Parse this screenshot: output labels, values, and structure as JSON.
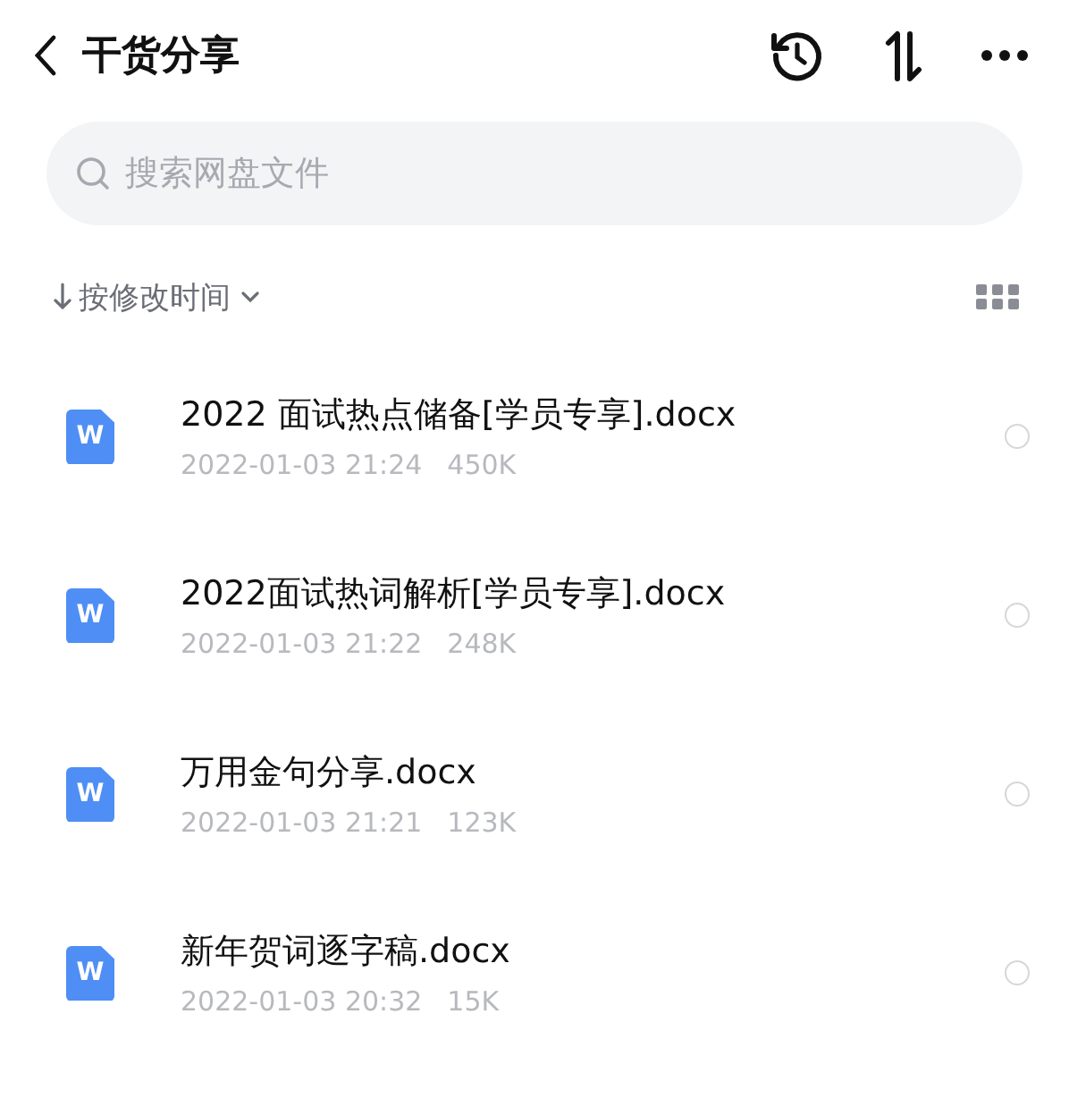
{
  "header": {
    "title": "干货分享"
  },
  "search": {
    "placeholder": "搜索网盘文件"
  },
  "sort": {
    "label": "按修改时间"
  },
  "files": [
    {
      "name": "2022 面试热点储备[学员专享].docx",
      "date": "2022-01-03 21:24",
      "size": "450K",
      "icon_letter": "W",
      "selected": false
    },
    {
      "name": "2022面试热词解析[学员专享].docx",
      "date": "2022-01-03 21:22",
      "size": "248K",
      "icon_letter": "W",
      "selected": false
    },
    {
      "name": "万用金句分享.docx",
      "date": "2022-01-03 21:21",
      "size": "123K",
      "icon_letter": "W",
      "selected": false
    },
    {
      "name": "新年贺词逐字稿.docx",
      "date": "2022-01-03 20:32",
      "size": "15K",
      "icon_letter": "W",
      "selected": false
    }
  ]
}
